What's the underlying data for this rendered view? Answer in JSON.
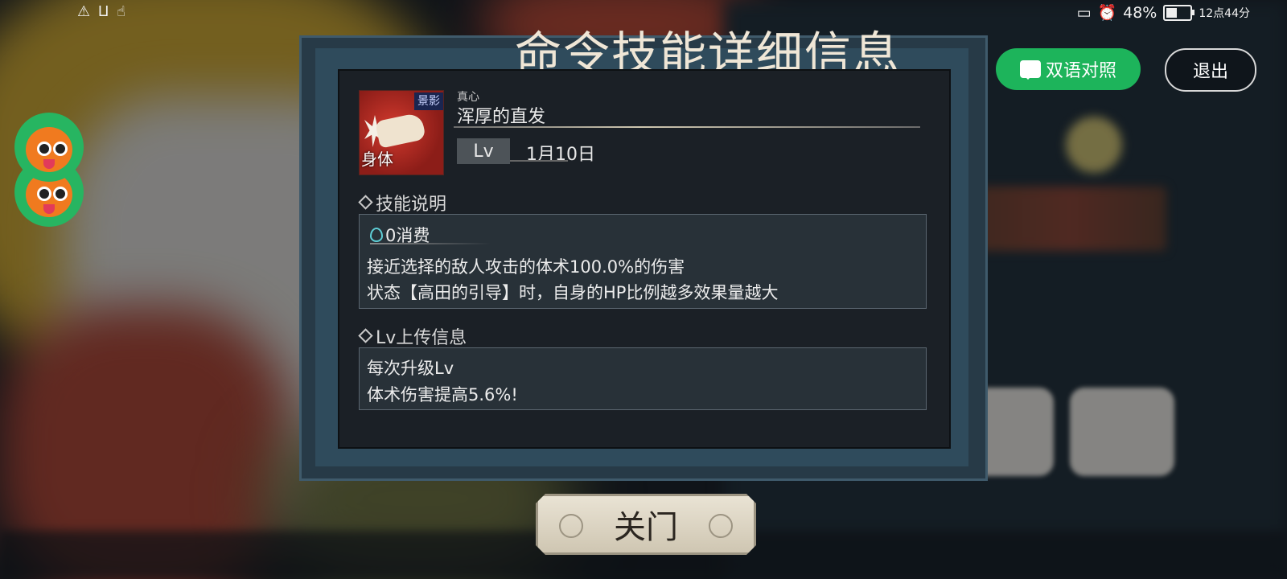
{
  "status_bar": {
    "icons": [
      "alert-icon",
      "wifi-icon",
      "touch-icon"
    ],
    "battery_percent": "48%",
    "battery_level": 0.48,
    "time": "12点44分"
  },
  "top_buttons": {
    "bilingual_label": "双语对照",
    "exit_label": "退出"
  },
  "dialog": {
    "title": "命令技能详细信息",
    "skill": {
      "icon_tag": "景影",
      "category": "身体",
      "subtitle": "真心",
      "name": "浑厚的直发",
      "lv_label": "Lv",
      "lv_value": "1月10日"
    },
    "description": {
      "section_title": "技能说明",
      "cost": "0消费",
      "lines": [
        "接近选择的敌人攻击的体术100.0%的伤害",
        "状态【高田的引导】时，自身的HP比例越多效果量越大"
      ]
    },
    "upgrade": {
      "section_title": "Lv上传信息",
      "lines": [
        "每次升级Lv",
        "体术伤害提高5.6%!"
      ]
    },
    "close_label": "关门"
  },
  "colors": {
    "bilingual_bg": "#1db45b",
    "panel_bg": "#1b2026",
    "frame": "#2f4b5c"
  }
}
